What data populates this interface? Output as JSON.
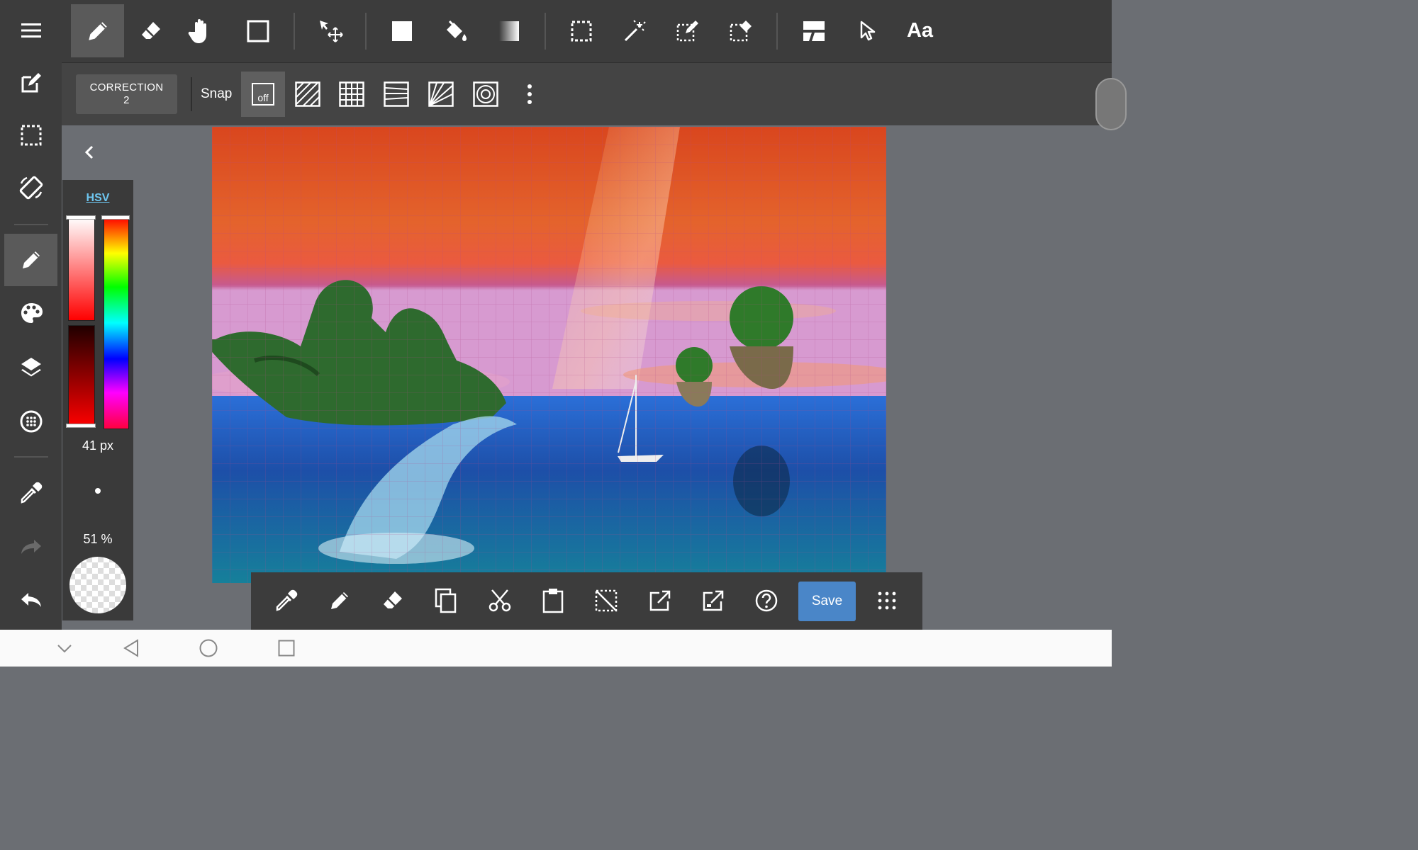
{
  "left_toolbar": {
    "items": [
      {
        "name": "menu-icon"
      },
      {
        "name": "edit-document-icon"
      },
      {
        "name": "selection-icon"
      },
      {
        "name": "rotate-screen-icon"
      },
      {
        "name": "pencil-icon",
        "active": true
      },
      {
        "name": "palette-icon"
      },
      {
        "name": "layers-icon"
      },
      {
        "name": "grid-dots-icon"
      },
      {
        "name": "eyedropper-icon"
      },
      {
        "name": "redo-icon",
        "disabled": true
      },
      {
        "name": "undo-icon"
      }
    ]
  },
  "top_toolbar": {
    "tools": [
      {
        "name": "pencil-tool-icon",
        "active": true
      },
      {
        "name": "eraser-tool-icon"
      },
      {
        "name": "hand-tool-icon"
      },
      {
        "name": "rectangle-tool-icon"
      },
      {
        "name": "move-tool-icon"
      },
      {
        "name": "fill-rect-tool-icon"
      },
      {
        "name": "bucket-tool-icon"
      },
      {
        "name": "gradient-tool-icon"
      },
      {
        "name": "select-rect-tool-icon"
      },
      {
        "name": "magic-wand-tool-icon"
      },
      {
        "name": "select-pen-tool-icon"
      },
      {
        "name": "select-eraser-tool-icon"
      },
      {
        "name": "frame-divider-tool-icon"
      },
      {
        "name": "pointer-tool-icon"
      },
      {
        "name": "text-tool-icon",
        "label": "Aa"
      }
    ]
  },
  "sub_toolbar": {
    "correction_label": "CORRECTION",
    "correction_value": "2",
    "snap_label": "Snap",
    "snap_off_label": "off",
    "snap_options": [
      "snap-off-icon",
      "snap-parallel-icon",
      "snap-grid-icon",
      "snap-horizontal-icon",
      "snap-radial-icon",
      "snap-circle-icon"
    ]
  },
  "color_panel": {
    "mode_label": "HSV",
    "brush_size": "41 px",
    "opacity": "51 %",
    "colors": {
      "primary": "#ff0000"
    }
  },
  "bottom_toolbar": {
    "items": [
      "eyedropper-icon",
      "pencil-icon",
      "eraser-icon",
      "copy-icon",
      "cut-icon",
      "paste-icon",
      "deselect-icon",
      "export-icon",
      "share-icon",
      "help-icon"
    ],
    "save_label": "Save",
    "apps_icon": "apps-grid-icon"
  },
  "android_nav": {
    "items": [
      "chevron-down-icon",
      "back-icon",
      "home-icon",
      "recents-icon"
    ]
  },
  "accent_colors": {
    "save": "#4a86c8",
    "hsv_link": "#6ec6f0",
    "sky_top": "#d9461e",
    "sea": "#1d4fa8"
  }
}
